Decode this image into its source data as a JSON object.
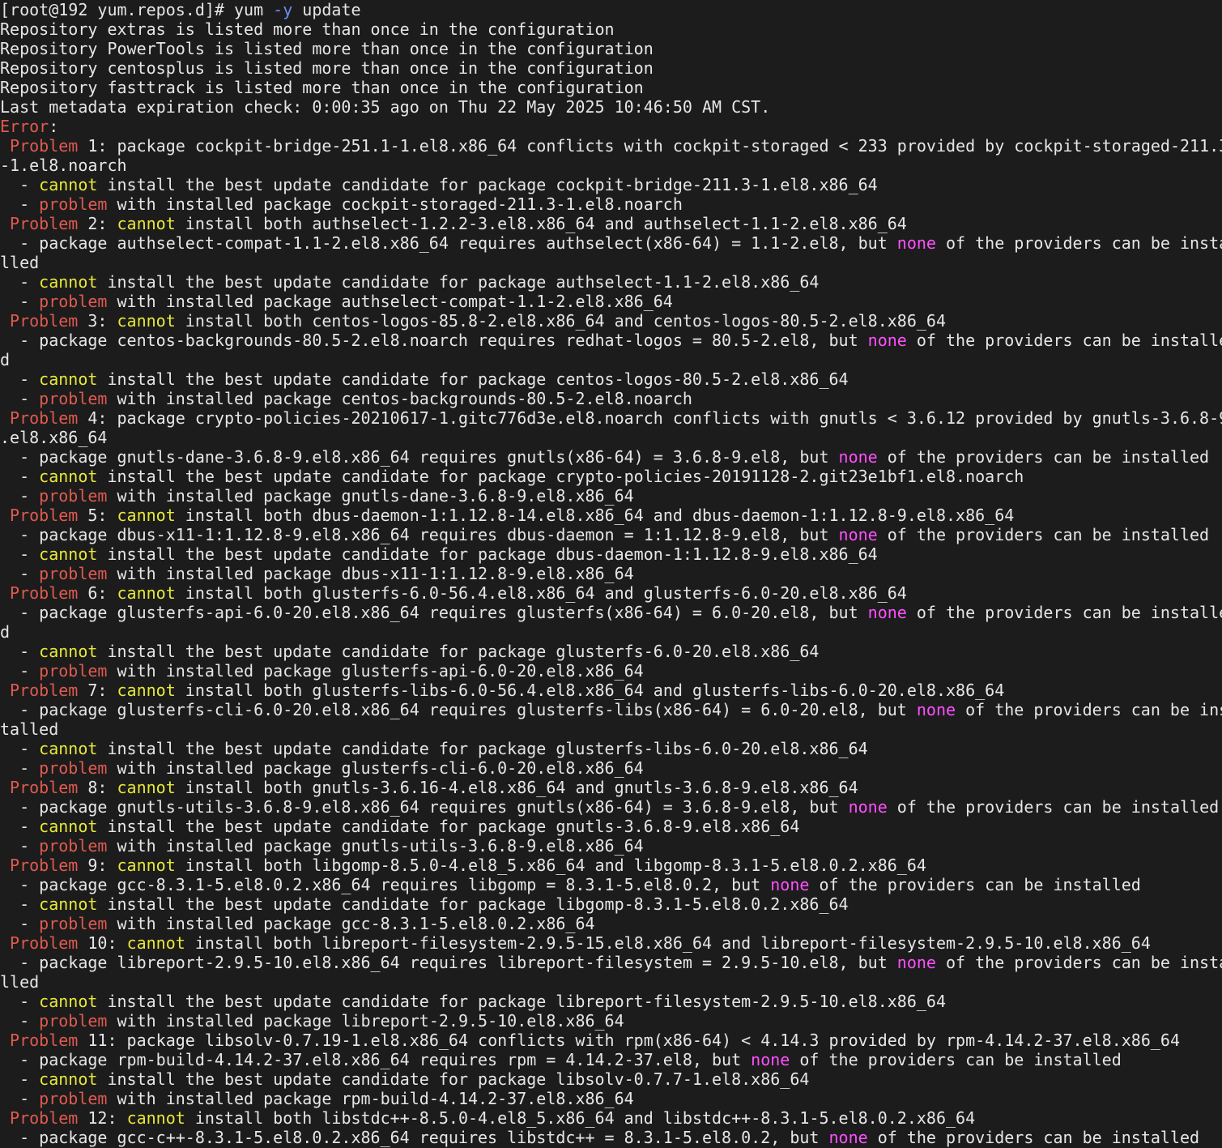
{
  "terminal": {
    "colors": {
      "background": "#1c1c1c",
      "text": "#e6e6e6",
      "red": "#e05a4f",
      "yellow": "#e8e83a",
      "magenta": "#ff4fff",
      "blue": "#6f8df8"
    },
    "lines": [
      [
        {
          "t": "[root@192 yum.repos.d]# yum "
        },
        {
          "t": "-y",
          "c": "blue"
        },
        {
          "t": " update"
        }
      ],
      [
        {
          "t": "Repository extras is listed more than once in the configuration"
        }
      ],
      [
        {
          "t": "Repository PowerTools is listed more than once in the configuration"
        }
      ],
      [
        {
          "t": "Repository centosplus is listed more than once in the configuration"
        }
      ],
      [
        {
          "t": "Repository fasttrack is listed more than once in the configuration"
        }
      ],
      [
        {
          "t": "Last metadata expiration check: 0:00:35 ago on Thu 22 May 2025 10:46:50 AM CST."
        }
      ],
      [
        {
          "t": "Error",
          "c": "red"
        },
        {
          "t": ":"
        }
      ],
      [
        {
          "t": " "
        },
        {
          "t": "Problem",
          "c": "red"
        },
        {
          "t": " 1: package cockpit-bridge-251.1-1.el8.x86_64 conflicts with cockpit-storaged < 233 provided by cockpit-storaged-211.3"
        }
      ],
      [
        {
          "t": "-1.el8.noarch"
        }
      ],
      [
        {
          "t": "  - "
        },
        {
          "t": "cannot",
          "c": "yellow"
        },
        {
          "t": " install the best update candidate for package cockpit-bridge-211.3-1.el8.x86_64"
        }
      ],
      [
        {
          "t": "  - "
        },
        {
          "t": "problem",
          "c": "red"
        },
        {
          "t": " with installed package cockpit-storaged-211.3-1.el8.noarch"
        }
      ],
      [
        {
          "t": " "
        },
        {
          "t": "Problem",
          "c": "red"
        },
        {
          "t": " 2: "
        },
        {
          "t": "cannot",
          "c": "yellow"
        },
        {
          "t": " install both authselect-1.2.2-3.el8.x86_64 and authselect-1.1-2.el8.x86_64"
        }
      ],
      [
        {
          "t": "  - package authselect-compat-1.1-2.el8.x86_64 requires authselect(x86-64) = 1.1-2.el8, but "
        },
        {
          "t": "none",
          "c": "magenta"
        },
        {
          "t": " of the providers can be insta"
        }
      ],
      [
        {
          "t": "lled"
        }
      ],
      [
        {
          "t": "  - "
        },
        {
          "t": "cannot",
          "c": "yellow"
        },
        {
          "t": " install the best update candidate for package authselect-1.1-2.el8.x86_64"
        }
      ],
      [
        {
          "t": "  - "
        },
        {
          "t": "problem",
          "c": "red"
        },
        {
          "t": " with installed package authselect-compat-1.1-2.el8.x86_64"
        }
      ],
      [
        {
          "t": " "
        },
        {
          "t": "Problem",
          "c": "red"
        },
        {
          "t": " 3: "
        },
        {
          "t": "cannot",
          "c": "yellow"
        },
        {
          "t": " install both centos-logos-85.8-2.el8.x86_64 and centos-logos-80.5-2.el8.x86_64"
        }
      ],
      [
        {
          "t": "  - package centos-backgrounds-80.5-2.el8.noarch requires redhat-logos = 80.5-2.el8, but "
        },
        {
          "t": "none",
          "c": "magenta"
        },
        {
          "t": " of the providers can be installe"
        }
      ],
      [
        {
          "t": "d"
        }
      ],
      [
        {
          "t": "  - "
        },
        {
          "t": "cannot",
          "c": "yellow"
        },
        {
          "t": " install the best update candidate for package centos-logos-80.5-2.el8.x86_64"
        }
      ],
      [
        {
          "t": "  - "
        },
        {
          "t": "problem",
          "c": "red"
        },
        {
          "t": " with installed package centos-backgrounds-80.5-2.el8.noarch"
        }
      ],
      [
        {
          "t": " "
        },
        {
          "t": "Problem",
          "c": "red"
        },
        {
          "t": " 4: package crypto-policies-20210617-1.gitc776d3e.el8.noarch conflicts with gnutls < 3.6.12 provided by gnutls-3.6.8-9"
        }
      ],
      [
        {
          "t": ".el8.x86_64"
        }
      ],
      [
        {
          "t": "  - package gnutls-dane-3.6.8-9.el8.x86_64 requires gnutls(x86-64) = 3.6.8-9.el8, but "
        },
        {
          "t": "none",
          "c": "magenta"
        },
        {
          "t": " of the providers can be installed"
        }
      ],
      [
        {
          "t": "  - "
        },
        {
          "t": "cannot",
          "c": "yellow"
        },
        {
          "t": " install the best update candidate for package crypto-policies-20191128-2.git23e1bf1.el8.noarch"
        }
      ],
      [
        {
          "t": "  - "
        },
        {
          "t": "problem",
          "c": "red"
        },
        {
          "t": " with installed package gnutls-dane-3.6.8-9.el8.x86_64"
        }
      ],
      [
        {
          "t": " "
        },
        {
          "t": "Problem",
          "c": "red"
        },
        {
          "t": " 5: "
        },
        {
          "t": "cannot",
          "c": "yellow"
        },
        {
          "t": " install both dbus-daemon-1:1.12.8-14.el8.x86_64 and dbus-daemon-1:1.12.8-9.el8.x86_64"
        }
      ],
      [
        {
          "t": "  - package dbus-x11-1:1.12.8-9.el8.x86_64 requires dbus-daemon = 1:1.12.8-9.el8, but "
        },
        {
          "t": "none",
          "c": "magenta"
        },
        {
          "t": " of the providers can be installed"
        }
      ],
      [
        {
          "t": "  - "
        },
        {
          "t": "cannot",
          "c": "yellow"
        },
        {
          "t": " install the best update candidate for package dbus-daemon-1:1.12.8-9.el8.x86_64"
        }
      ],
      [
        {
          "t": "  - "
        },
        {
          "t": "problem",
          "c": "red"
        },
        {
          "t": " with installed package dbus-x11-1:1.12.8-9.el8.x86_64"
        }
      ],
      [
        {
          "t": " "
        },
        {
          "t": "Problem",
          "c": "red"
        },
        {
          "t": " 6: "
        },
        {
          "t": "cannot",
          "c": "yellow"
        },
        {
          "t": " install both glusterfs-6.0-56.4.el8.x86_64 and glusterfs-6.0-20.el8.x86_64"
        }
      ],
      [
        {
          "t": "  - package glusterfs-api-6.0-20.el8.x86_64 requires glusterfs(x86-64) = 6.0-20.el8, but "
        },
        {
          "t": "none",
          "c": "magenta"
        },
        {
          "t": " of the providers can be installe"
        }
      ],
      [
        {
          "t": "d"
        }
      ],
      [
        {
          "t": "  - "
        },
        {
          "t": "cannot",
          "c": "yellow"
        },
        {
          "t": " install the best update candidate for package glusterfs-6.0-20.el8.x86_64"
        }
      ],
      [
        {
          "t": "  - "
        },
        {
          "t": "problem",
          "c": "red"
        },
        {
          "t": " with installed package glusterfs-api-6.0-20.el8.x86_64"
        }
      ],
      [
        {
          "t": " "
        },
        {
          "t": "Problem",
          "c": "red"
        },
        {
          "t": " 7: "
        },
        {
          "t": "cannot",
          "c": "yellow"
        },
        {
          "t": " install both glusterfs-libs-6.0-56.4.el8.x86_64 and glusterfs-libs-6.0-20.el8.x86_64"
        }
      ],
      [
        {
          "t": "  - package glusterfs-cli-6.0-20.el8.x86_64 requires glusterfs-libs(x86-64) = 6.0-20.el8, but "
        },
        {
          "t": "none",
          "c": "magenta"
        },
        {
          "t": " of the providers can be ins"
        }
      ],
      [
        {
          "t": "talled"
        }
      ],
      [
        {
          "t": "  - "
        },
        {
          "t": "cannot",
          "c": "yellow"
        },
        {
          "t": " install the best update candidate for package glusterfs-libs-6.0-20.el8.x86_64"
        }
      ],
      [
        {
          "t": "  - "
        },
        {
          "t": "problem",
          "c": "red"
        },
        {
          "t": " with installed package glusterfs-cli-6.0-20.el8.x86_64"
        }
      ],
      [
        {
          "t": " "
        },
        {
          "t": "Problem",
          "c": "red"
        },
        {
          "t": " 8: "
        },
        {
          "t": "cannot",
          "c": "yellow"
        },
        {
          "t": " install both gnutls-3.6.16-4.el8.x86_64 and gnutls-3.6.8-9.el8.x86_64"
        }
      ],
      [
        {
          "t": "  - package gnutls-utils-3.6.8-9.el8.x86_64 requires gnutls(x86-64) = 3.6.8-9.el8, but "
        },
        {
          "t": "none",
          "c": "magenta"
        },
        {
          "t": " of the providers can be installed"
        }
      ],
      [
        {
          "t": "  - "
        },
        {
          "t": "cannot",
          "c": "yellow"
        },
        {
          "t": " install the best update candidate for package gnutls-3.6.8-9.el8.x86_64"
        }
      ],
      [
        {
          "t": "  - "
        },
        {
          "t": "problem",
          "c": "red"
        },
        {
          "t": " with installed package gnutls-utils-3.6.8-9.el8.x86_64"
        }
      ],
      [
        {
          "t": " "
        },
        {
          "t": "Problem",
          "c": "red"
        },
        {
          "t": " 9: "
        },
        {
          "t": "cannot",
          "c": "yellow"
        },
        {
          "t": " install both libgomp-8.5.0-4.el8_5.x86_64 and libgomp-8.3.1-5.el8.0.2.x86_64"
        }
      ],
      [
        {
          "t": "  - package gcc-8.3.1-5.el8.0.2.x86_64 requires libgomp = 8.3.1-5.el8.0.2, but "
        },
        {
          "t": "none",
          "c": "magenta"
        },
        {
          "t": " of the providers can be installed"
        }
      ],
      [
        {
          "t": "  - "
        },
        {
          "t": "cannot",
          "c": "yellow"
        },
        {
          "t": " install the best update candidate for package libgomp-8.3.1-5.el8.0.2.x86_64"
        }
      ],
      [
        {
          "t": "  - "
        },
        {
          "t": "problem",
          "c": "red"
        },
        {
          "t": " with installed package gcc-8.3.1-5.el8.0.2.x86_64"
        }
      ],
      [
        {
          "t": " "
        },
        {
          "t": "Problem",
          "c": "red"
        },
        {
          "t": " 10: "
        },
        {
          "t": "cannot",
          "c": "yellow"
        },
        {
          "t": " install both libreport-filesystem-2.9.5-15.el8.x86_64 and libreport-filesystem-2.9.5-10.el8.x86_64"
        }
      ],
      [
        {
          "t": "  - package libreport-2.9.5-10.el8.x86_64 requires libreport-filesystem = 2.9.5-10.el8, but "
        },
        {
          "t": "none",
          "c": "magenta"
        },
        {
          "t": " of the providers can be insta"
        }
      ],
      [
        {
          "t": "lled"
        }
      ],
      [
        {
          "t": "  - "
        },
        {
          "t": "cannot",
          "c": "yellow"
        },
        {
          "t": " install the best update candidate for package libreport-filesystem-2.9.5-10.el8.x86_64"
        }
      ],
      [
        {
          "t": "  - "
        },
        {
          "t": "problem",
          "c": "red"
        },
        {
          "t": " with installed package libreport-2.9.5-10.el8.x86_64"
        }
      ],
      [
        {
          "t": " "
        },
        {
          "t": "Problem",
          "c": "red"
        },
        {
          "t": " 11: package libsolv-0.7.19-1.el8.x86_64 conflicts with rpm(x86-64) < 4.14.3 provided by rpm-4.14.2-37.el8.x86_64"
        }
      ],
      [
        {
          "t": "  - package rpm-build-4.14.2-37.el8.x86_64 requires rpm = 4.14.2-37.el8, but "
        },
        {
          "t": "none",
          "c": "magenta"
        },
        {
          "t": " of the providers can be installed"
        }
      ],
      [
        {
          "t": "  - "
        },
        {
          "t": "cannot",
          "c": "yellow"
        },
        {
          "t": " install the best update candidate for package libsolv-0.7.7-1.el8.x86_64"
        }
      ],
      [
        {
          "t": "  - "
        },
        {
          "t": "problem",
          "c": "red"
        },
        {
          "t": " with installed package rpm-build-4.14.2-37.el8.x86_64"
        }
      ],
      [
        {
          "t": " "
        },
        {
          "t": "Problem",
          "c": "red"
        },
        {
          "t": " 12: "
        },
        {
          "t": "cannot",
          "c": "yellow"
        },
        {
          "t": " install both libstdc++-8.5.0-4.el8_5.x86_64 and libstdc++-8.3.1-5.el8.0.2.x86_64"
        }
      ],
      [
        {
          "t": "  - package gcc-c++-8.3.1-5.el8.0.2.x86_64 requires libstdc++ = 8.3.1-5.el8.0.2, but "
        },
        {
          "t": "none",
          "c": "magenta"
        },
        {
          "t": " of the providers can be installed"
        }
      ]
    ]
  }
}
